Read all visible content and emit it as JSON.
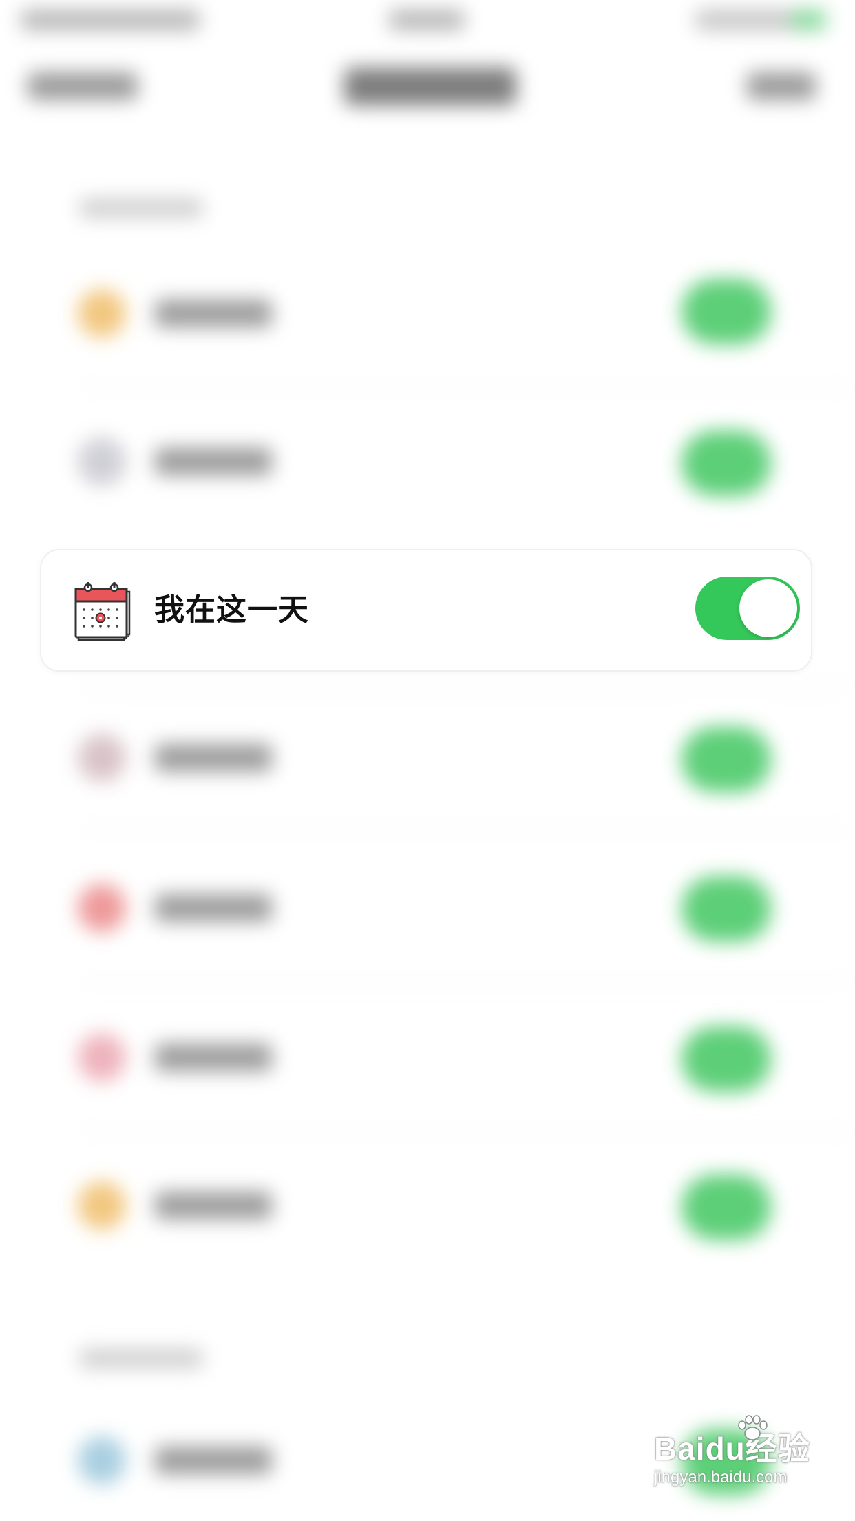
{
  "screen": {
    "background": "#ffffff"
  },
  "focused_row": {
    "title": "我在这一天",
    "icon": "calendar-icon",
    "toggle_on": true,
    "toggle_color": "#34c759"
  },
  "blurred_rows": [
    {
      "icon_color": "#f2c77f",
      "toggle_on": true
    },
    {
      "icon_color": "#cfcfd6",
      "toggle_on": true
    },
    {
      "icon_color": "#d8c3c8",
      "toggle_on": true
    },
    {
      "icon_color": "#ee9a9a",
      "toggle_on": true
    },
    {
      "icon_color": "#eeb3bc",
      "toggle_on": true
    },
    {
      "icon_color": "#f2c77f",
      "toggle_on": true
    },
    {
      "icon_color": "#a9cfe0",
      "toggle_on": true
    }
  ],
  "watermark": {
    "brand": "Baidu经验",
    "url": "jingyan.baidu.com"
  }
}
